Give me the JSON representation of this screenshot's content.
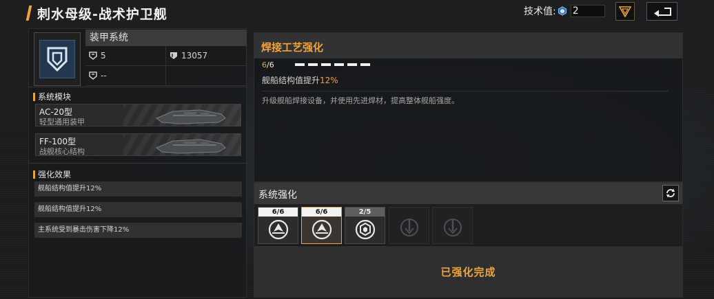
{
  "header": {
    "title": "刺水母级-战术护卫舰",
    "tech_label": "技术值:",
    "tech_value": "2"
  },
  "armor": {
    "title": "装甲系统",
    "stats": [
      {
        "icon": "armor-shield-icon",
        "value": "5"
      },
      {
        "icon": "structure-shield-icon",
        "value": "13057"
      },
      {
        "icon": "armor-shield-icon",
        "value": "--"
      }
    ]
  },
  "modules": {
    "heading": "系统模块",
    "items": [
      {
        "name": "AC-20型",
        "desc": "轻型通用装甲"
      },
      {
        "name": "FF-100型",
        "desc": "战舰核心结构"
      }
    ]
  },
  "effects": {
    "heading": "强化效果",
    "items": [
      "舰船结构值提升12%",
      "舰船结构值提升12%",
      "主系统受到暴击伤害下降12%"
    ]
  },
  "detail": {
    "title": "焊接工艺强化",
    "level_current": "6",
    "level_max": "/6",
    "pips_filled": 6,
    "effect_text": "舰船结构值提升",
    "effect_value": "12%",
    "description": "升级舰船焊接设备，并使用先进焊材，提高整体舰船强度。"
  },
  "enhance": {
    "title": "系统强化",
    "slots": [
      {
        "count": "6/6",
        "state": "full",
        "icon": "hull-upgrade-icon",
        "selected": false
      },
      {
        "count": "6/6",
        "state": "full",
        "icon": "hull-upgrade-icon",
        "selected": true
      },
      {
        "count": "2/5",
        "state": "partial",
        "icon": "hex-shield-upgrade-icon",
        "selected": false
      },
      {
        "count": "",
        "state": "locked",
        "icon": "locked-upgrade-icon",
        "selected": false
      },
      {
        "count": "",
        "state": "locked",
        "icon": "locked-upgrade-icon",
        "selected": false
      }
    ],
    "status": "已强化完成"
  },
  "colors": {
    "accent": "#f0a43a",
    "icon_blue": "#23384f"
  }
}
